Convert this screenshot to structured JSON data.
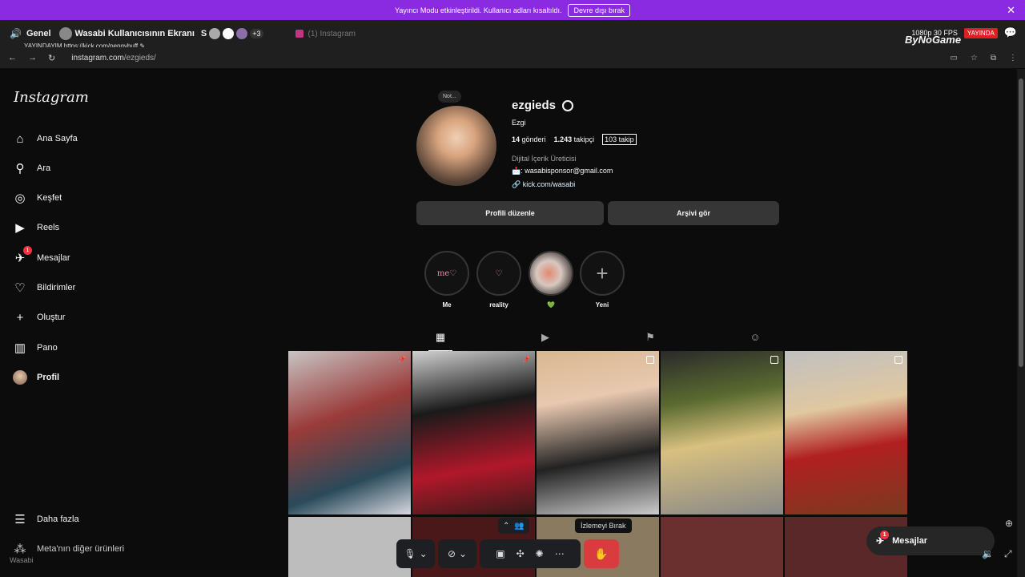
{
  "banner": {
    "text": "Yayıncı Modu etkinleştirildi. Kullanıcı adları kısaltıldı.",
    "button": "Devre dışı bırak",
    "close": "✕"
  },
  "call": {
    "channel": "Genel",
    "screen_title": "Wasabi Kullanıcısının Ekranı",
    "s_label": "S",
    "extra_count": "+3",
    "tab2": "(1) Instagram",
    "brand": "ByNoGame",
    "fps": "1080p 30 FPS",
    "live": "YAYINDA"
  },
  "streamer": "YAYINDAYIM https://kick.com/pengybuff ✎",
  "browser": {
    "url_host": "instagram.com",
    "url_path": "/ezgieds/"
  },
  "sidebar": {
    "logo": "Instagram",
    "items": [
      {
        "label": "Ana Sayfa",
        "icon": "⌂"
      },
      {
        "label": "Ara",
        "icon": "⚲"
      },
      {
        "label": "Keşfet",
        "icon": "◎"
      },
      {
        "label": "Reels",
        "icon": "▶"
      },
      {
        "label": "Mesajlar",
        "icon": "✈",
        "badge": "1"
      },
      {
        "label": "Bildirimler",
        "icon": "♡"
      },
      {
        "label": "Oluştur",
        "icon": "+"
      },
      {
        "label": "Pano",
        "icon": "▥"
      },
      {
        "label": "Profil",
        "icon": ""
      }
    ],
    "more": "Daha fazla",
    "meta": "Meta'nın diğer ürünleri",
    "watermark": "Wasabi"
  },
  "profile": {
    "note": "Not...",
    "username": "ezgieds",
    "full_name": "Ezgi",
    "posts_count": "14",
    "posts_label": "gönderi",
    "followers_count": "1.243",
    "followers_label": "takipçi",
    "following": "103 takip",
    "category": "Dijital İçerik Üreticisi",
    "email": "📩: wasabisponsor@gmail.com",
    "link": "kick.com/wasabi",
    "edit_button": "Profili düzenle",
    "archive_button": "Arşivi gör"
  },
  "highlights": [
    {
      "label": "Me",
      "cover": "me♡"
    },
    {
      "label": "reality",
      "cover": "♡"
    },
    {
      "label": "💚",
      "cover": ""
    },
    {
      "label": "Yeni",
      "cover": "+"
    }
  ],
  "tabs": [
    {
      "name": "posts",
      "icon": "▦"
    },
    {
      "name": "reels",
      "icon": "▶"
    },
    {
      "name": "saved",
      "icon": "⚑"
    },
    {
      "name": "tagged",
      "icon": "☺"
    }
  ],
  "call_controls": {
    "tooltip": "İzlemeyi Bırak",
    "chevron": "⌃"
  },
  "messages_pill": {
    "label": "Mesajlar",
    "badge": "1"
  },
  "colors": {
    "accent_banner": "#8a2be2",
    "badge": "#ff3040",
    "stop_button": "#d83c3e"
  }
}
